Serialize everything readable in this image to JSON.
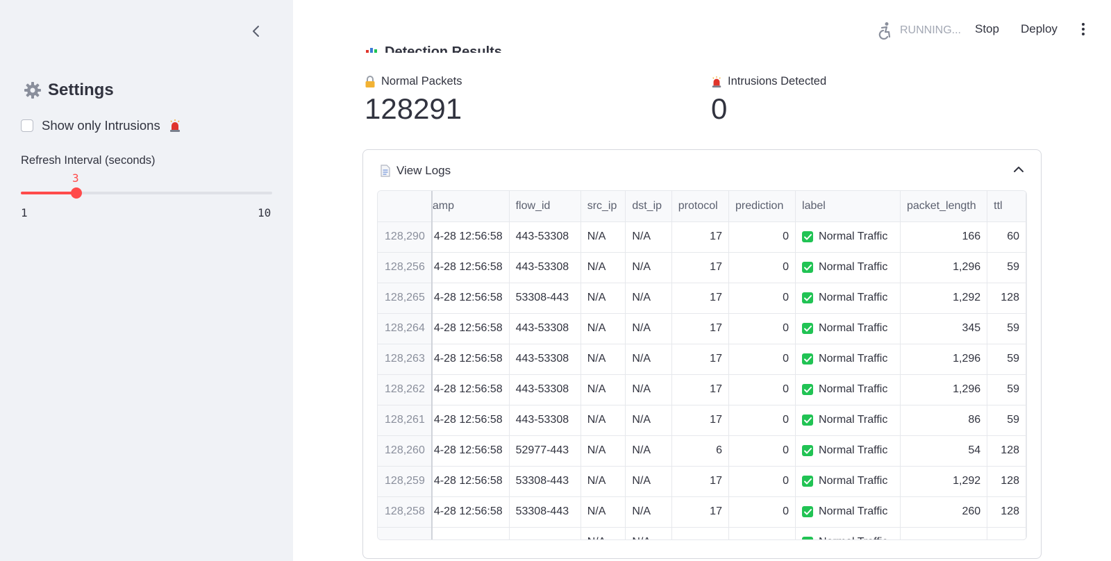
{
  "sidebar": {
    "settings_title": "Settings",
    "show_only_intrusions_label": "Show only Intrusions",
    "show_only_intrusions_checked": false,
    "refresh_interval": {
      "label": "Refresh Interval (seconds)",
      "value": "3",
      "min": "1",
      "max": "10",
      "fraction": 0.2222
    }
  },
  "toolbar": {
    "status": "RUNNING...",
    "stop_label": "Stop",
    "deploy_label": "Deploy"
  },
  "main": {
    "section_header": "Detection Results",
    "metrics": [
      {
        "label": "Normal Packets",
        "value": "128291"
      },
      {
        "label": "Intrusions Detected",
        "value": "0"
      }
    ],
    "expander_label": "View Logs",
    "table": {
      "columns": [
        "",
        "amp",
        "flow_id",
        "src_ip",
        "dst_ip",
        "protocol",
        "prediction",
        "label",
        "packet_length",
        "ttl"
      ],
      "rows": [
        [
          "128,290",
          "4-28 12:56:58",
          "443-53308",
          "N/A",
          "N/A",
          "17",
          "0",
          "Normal Traffic",
          "166",
          "60"
        ],
        [
          "128,256",
          "4-28 12:56:58",
          "443-53308",
          "N/A",
          "N/A",
          "17",
          "0",
          "Normal Traffic",
          "1,296",
          "59"
        ],
        [
          "128,265",
          "4-28 12:56:58",
          "53308-443",
          "N/A",
          "N/A",
          "17",
          "0",
          "Normal Traffic",
          "1,292",
          "128"
        ],
        [
          "128,264",
          "4-28 12:56:58",
          "443-53308",
          "N/A",
          "N/A",
          "17",
          "0",
          "Normal Traffic",
          "345",
          "59"
        ],
        [
          "128,263",
          "4-28 12:56:58",
          "443-53308",
          "N/A",
          "N/A",
          "17",
          "0",
          "Normal Traffic",
          "1,296",
          "59"
        ],
        [
          "128,262",
          "4-28 12:56:58",
          "443-53308",
          "N/A",
          "N/A",
          "17",
          "0",
          "Normal Traffic",
          "1,296",
          "59"
        ],
        [
          "128,261",
          "4-28 12:56:58",
          "443-53308",
          "N/A",
          "N/A",
          "17",
          "0",
          "Normal Traffic",
          "86",
          "59"
        ],
        [
          "128,260",
          "4-28 12:56:58",
          "52977-443",
          "N/A",
          "N/A",
          "6",
          "0",
          "Normal Traffic",
          "54",
          "128"
        ],
        [
          "128,259",
          "4-28 12:56:58",
          "53308-443",
          "N/A",
          "N/A",
          "17",
          "0",
          "Normal Traffic",
          "1,292",
          "128"
        ],
        [
          "128,258",
          "4-28 12:56:58",
          "53308-443",
          "N/A",
          "N/A",
          "17",
          "0",
          "Normal Traffic",
          "260",
          "128"
        ],
        [
          "",
          "",
          "",
          "N/A",
          "N/A",
          "",
          "",
          "Normal Traffic",
          "",
          ""
        ]
      ]
    }
  },
  "colors": {
    "accent": "#ff4b4b",
    "sidebar_bg": "#f0f2f6",
    "check_green": "#21c354"
  }
}
